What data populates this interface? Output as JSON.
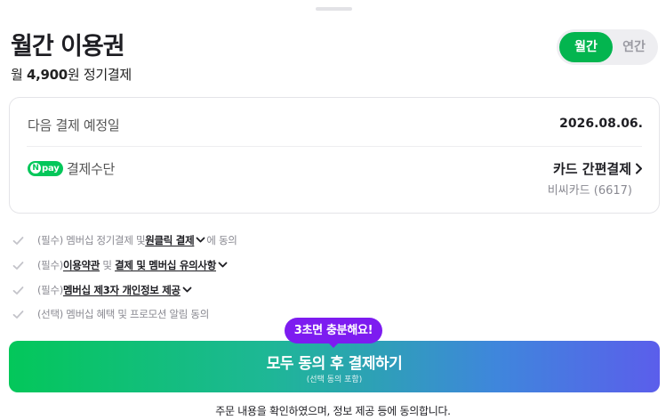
{
  "header": {
    "title": "월간 이용권",
    "price_prefix": "월 ",
    "price_amount": "4,900",
    "price_suffix": "원 정기결제"
  },
  "period_toggle": {
    "options": [
      "월간",
      "연간"
    ],
    "selected": "월간"
  },
  "billing": {
    "next_payment_label": "다음 결제 예정일",
    "next_payment_date": "2026.08.06.",
    "payment_method_badge": "pay",
    "payment_method_label": "결제수단",
    "payment_method_value": "카드 간편결제",
    "card_name": "비씨카드 (6617)"
  },
  "agreements": [
    {
      "prefix": "(필수) 멤버십 정기결제 및 ",
      "link": "원클릭 결제",
      "suffix": "에 동의"
    },
    {
      "prefix": "(필수) ",
      "link": "이용약관",
      "middle": " 및 ",
      "link2": "결제 및 멤버십 유의사항",
      "suffix": ""
    },
    {
      "prefix": "(필수) ",
      "link": "멤버십 제3자 개인정보 제공",
      "suffix": ""
    },
    {
      "prefix": "(선택) 멤버십 혜택 및 프로모션 알림 동의"
    }
  ],
  "cta": {
    "tooltip": "3초면 충분해요!",
    "label": "모두 동의 후 결제하기",
    "sublabel": "(선택 동의 포함)"
  },
  "footer": {
    "note": "주문 내용을 확인하였으며, 정보 제공 등에 동의합니다."
  },
  "colors": {
    "brand_green": "#03c75a",
    "toggle_active": "#03b54f",
    "tooltip_purple": "#7d1cf0",
    "gradient_end": "#5b5eeb"
  },
  "icons": [
    "check-icon",
    "chevron-down-icon",
    "chevron-right-icon",
    "npay-logo"
  ]
}
